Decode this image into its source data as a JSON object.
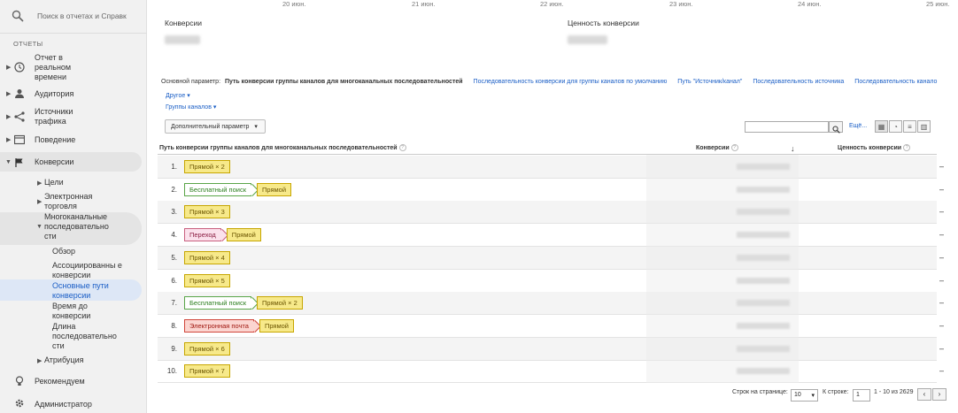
{
  "sidebar": {
    "search_placeholder": "Поиск в отчетах и Справк",
    "section_title": "ОТЧЕТЫ",
    "items": {
      "realtime": "Отчет в реальном времени",
      "audience": "Аудитория",
      "sources": "Источники трафика",
      "behavior": "Поведение",
      "conversions": "Конверсии",
      "goals": "Цели",
      "ecommerce": "Электронная торговля",
      "mcf": "Многоканальные последовательно сти",
      "overview": "Обзор",
      "assisted": "Ассоциированны е конверсии",
      "top_paths": "Основные пути конверсии",
      "time_lag": "Время до конверсии",
      "path_length": "Длина последовательно сти",
      "attribution": "Атрибуция",
      "recommended": "Рекомендуем",
      "admin": "Администратор"
    }
  },
  "chart_dates": [
    "20 июн.",
    "21 июн.",
    "22 июн.",
    "23 июн.",
    "24 июн.",
    "25 июн."
  ],
  "metrics": {
    "conversions_label": "Конверсии",
    "conversion_value_label": "Ценность конверсии"
  },
  "dimensions": {
    "label": "Основной параметр:",
    "current": "Путь конверсии группы каналов для многоканальных последовательностей",
    "opt1": "Последовательность конверсии для группы каналов по умолчанию",
    "opt2": "Путь \"Источник/канал\"",
    "opt3": "Последовательность источника",
    "opt4": "Последовательность канало",
    "other": "Другое",
    "channel_groups": "Группы каналов"
  },
  "toolbar": {
    "secondary_dim": "Дополнительный параметр",
    "more": "Ещё..."
  },
  "table": {
    "col_path": "Путь конверсии группы каналов для многоканальных последовательностей",
    "col_conversions": "Конверсии",
    "col_value": "Ценность конверсии",
    "rows": [
      {
        "num": "1.",
        "chips": [
          {
            "t": "Прямой × 2",
            "c": "yellow"
          }
        ],
        "dash": "–"
      },
      {
        "num": "2.",
        "chips": [
          {
            "t": "Бесплатный поиск",
            "c": "green"
          },
          {
            "t": "Прямой",
            "c": "yellow"
          }
        ],
        "dash": "–"
      },
      {
        "num": "3.",
        "chips": [
          {
            "t": "Прямой × 3",
            "c": "yellow"
          }
        ],
        "dash": "–"
      },
      {
        "num": "4.",
        "chips": [
          {
            "t": "Переход",
            "c": "pink"
          },
          {
            "t": "Прямой",
            "c": "yellow"
          }
        ],
        "dash": "–"
      },
      {
        "num": "5.",
        "chips": [
          {
            "t": "Прямой × 4",
            "c": "yellow"
          }
        ],
        "dash": "–"
      },
      {
        "num": "6.",
        "chips": [
          {
            "t": "Прямой × 5",
            "c": "yellow"
          }
        ],
        "dash": "–"
      },
      {
        "num": "7.",
        "chips": [
          {
            "t": "Бесплатный поиск",
            "c": "green"
          },
          {
            "t": "Прямой × 2",
            "c": "yellow"
          }
        ],
        "dash": "–"
      },
      {
        "num": "8.",
        "chips": [
          {
            "t": "Электронная почта",
            "c": "red"
          },
          {
            "t": "Прямой",
            "c": "yellow"
          }
        ],
        "dash": "–"
      },
      {
        "num": "9.",
        "chips": [
          {
            "t": "Прямой × 6",
            "c": "yellow"
          }
        ],
        "dash": "–"
      },
      {
        "num": "10.",
        "chips": [
          {
            "t": "Прямой × 7",
            "c": "yellow"
          }
        ],
        "dash": "–"
      }
    ]
  },
  "footer": {
    "rows_per_page_label": "Строк на странице:",
    "rows_per_page": "10",
    "goto_label": "К строке:",
    "goto_value": "1",
    "range": "1 - 10 из 2629"
  }
}
